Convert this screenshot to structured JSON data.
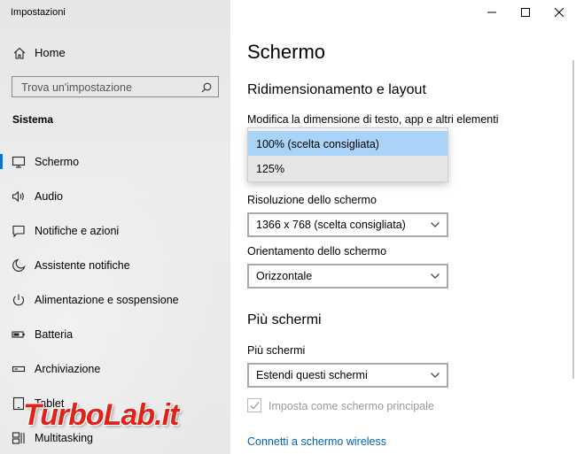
{
  "window": {
    "title": "Impostazioni"
  },
  "sidebar": {
    "home_label": "Home",
    "search_placeholder": "Trova un'impostazione",
    "section_label": "Sistema",
    "items": [
      {
        "label": "Schermo",
        "icon": "monitor-icon",
        "active": true
      },
      {
        "label": "Audio",
        "icon": "speaker-icon"
      },
      {
        "label": "Notifiche e azioni",
        "icon": "notification-icon"
      },
      {
        "label": "Assistente notifiche",
        "icon": "moon-icon"
      },
      {
        "label": "Alimentazione e sospensione",
        "icon": "power-icon"
      },
      {
        "label": "Batteria",
        "icon": "battery-icon"
      },
      {
        "label": "Archiviazione",
        "icon": "storage-icon"
      },
      {
        "label": "Tablet",
        "icon": "tablet-icon"
      },
      {
        "label": "Multitasking",
        "icon": "multitasking-icon"
      }
    ]
  },
  "main": {
    "title": "Schermo",
    "scale_heading": "Ridimensionamento e layout",
    "scale_label": "Modifica la dimensione di testo, app e altri elementi",
    "scale_options": [
      "100% (scelta consigliata)",
      "125%"
    ],
    "resolution_label": "Risoluzione dello schermo",
    "resolution_value": "1366 x 768 (scelta consigliata)",
    "orientation_label": "Orientamento dello schermo",
    "orientation_value": "Orizzontale",
    "multi_heading": "Più schermi",
    "multi_label": "Più schermi",
    "multi_value": "Estendi questi schermi",
    "primary_checkbox_label": "Imposta come schermo principale",
    "wireless_link": "Connetti a schermo wireless"
  },
  "watermark": {
    "text": "TurboLab.it"
  },
  "colors": {
    "accent": "#0078d7",
    "selection": "#a9d4f8",
    "link": "#0063b1",
    "watermark": "#e0231a"
  }
}
